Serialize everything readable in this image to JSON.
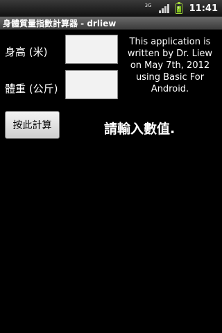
{
  "status_bar": {
    "network_label": "3G",
    "time": "11:41",
    "battery_level": 0.75,
    "icons": [
      "3g-icon",
      "signal-icon",
      "battery-charging-icon"
    ]
  },
  "app": {
    "title": "身體質量指數計算器 - drliew"
  },
  "form": {
    "height_label": "身高 (米)",
    "height_value": "",
    "weight_label": "體重 (公斤)",
    "weight_value": ""
  },
  "info_text": "This application is written by Dr. Liew on May 7th, 2012 using Basic For Android.",
  "calc_button_label": "按此計算",
  "result_text": "請輸入數值."
}
